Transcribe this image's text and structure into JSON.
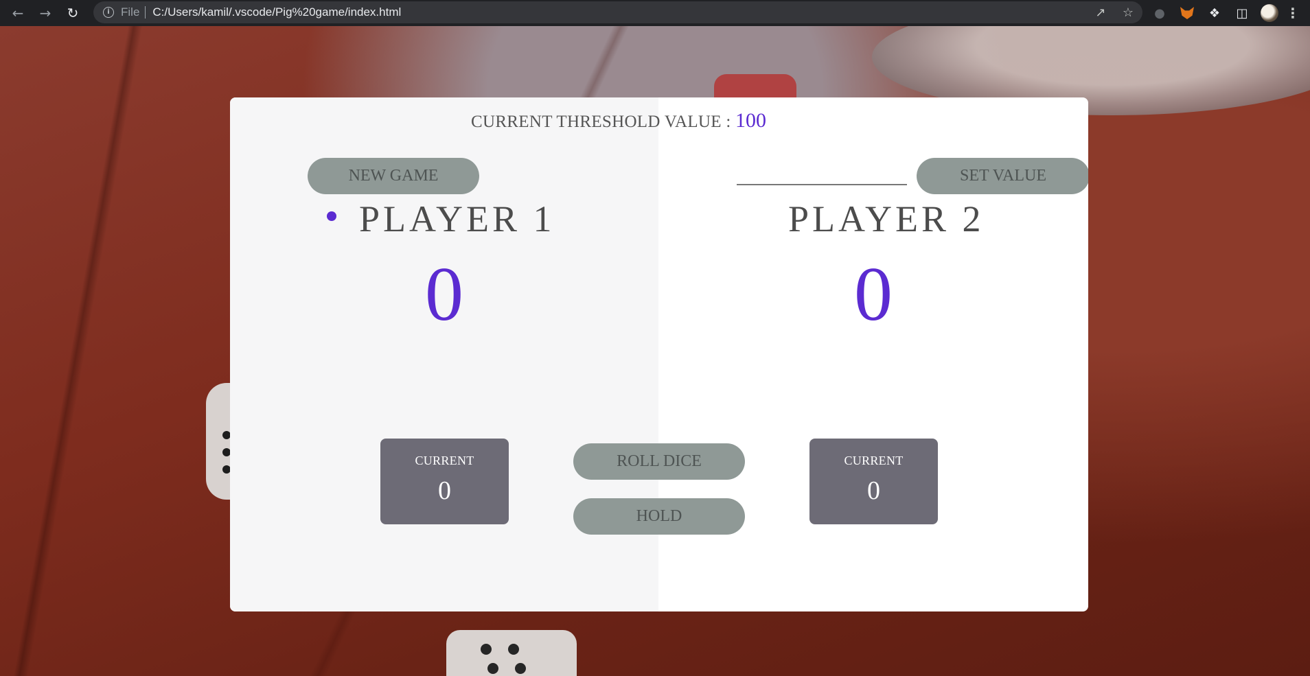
{
  "browser": {
    "scheme_label": "File",
    "url": "C:/Users/kamil/.vscode/Pig%20game/index.html",
    "icons": [
      "back-arrow-icon",
      "forward-arrow-icon",
      "reload-icon",
      "info-icon",
      "share-icon",
      "star-icon",
      "extension-robot-icon",
      "metamask-fox-icon",
      "puzzle-extensions-icon",
      "side-panel-icon",
      "profile-avatar",
      "menu-dots-icon"
    ]
  },
  "game": {
    "threshold_label": "CURRENT THRESHOLD VALUE :",
    "threshold_value": "100",
    "new_game_label": "NEW GAME",
    "set_value_label": "SET VALUE",
    "threshold_input_value": "",
    "roll_dice_label": "ROLL DICE",
    "hold_label": "HOLD",
    "active_player": 1,
    "accent_color": "#5b2bd1",
    "players": [
      {
        "name": "PLAYER 1",
        "score": "0",
        "current_label": "CURRENT",
        "current_value": "0"
      },
      {
        "name": "PLAYER 2",
        "score": "0",
        "current_label": "CURRENT",
        "current_value": "0"
      }
    ]
  }
}
